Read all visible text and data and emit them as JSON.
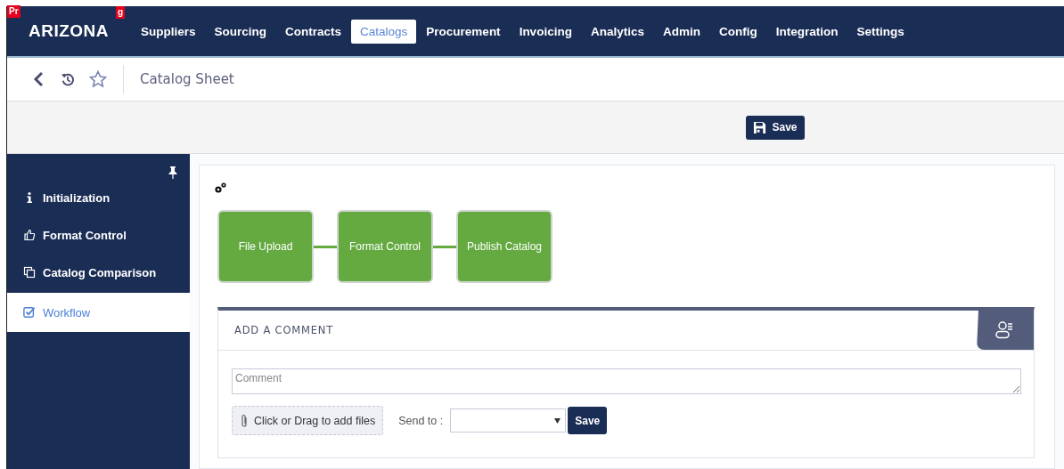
{
  "logo": {
    "text": "ARIZONA",
    "badge_left": "Pr",
    "badge_right": "g"
  },
  "nav": [
    {
      "label": "Suppliers",
      "selected": false
    },
    {
      "label": "Sourcing",
      "selected": false
    },
    {
      "label": "Contracts",
      "selected": false
    },
    {
      "label": "Catalogs",
      "selected": true
    },
    {
      "label": "Procurement",
      "selected": false
    },
    {
      "label": "Invoicing",
      "selected": false
    },
    {
      "label": "Analytics",
      "selected": false
    },
    {
      "label": "Admin",
      "selected": false
    },
    {
      "label": "Config",
      "selected": false
    },
    {
      "label": "Integration",
      "selected": false
    },
    {
      "label": "Settings",
      "selected": false
    }
  ],
  "page_title": "Catalog Sheet",
  "toolbar": {
    "save_label": "Save"
  },
  "sidebar": {
    "items": [
      {
        "label": "Initialization",
        "kind": "info",
        "selected": false
      },
      {
        "label": "Format Control",
        "kind": "thumb",
        "selected": false
      },
      {
        "label": "Catalog Comparison",
        "kind": "copy",
        "selected": false
      },
      {
        "label": "Workflow",
        "kind": "check",
        "selected": true
      }
    ]
  },
  "workflow": {
    "steps": [
      "File Upload",
      "Format Control",
      "Publish Catalog"
    ]
  },
  "comment": {
    "title": "ADD A COMMENT",
    "placeholder": "Comment",
    "attach_label": "Click or Drag to add files",
    "send_to_label": "Send to :",
    "save_label": "Save"
  }
}
